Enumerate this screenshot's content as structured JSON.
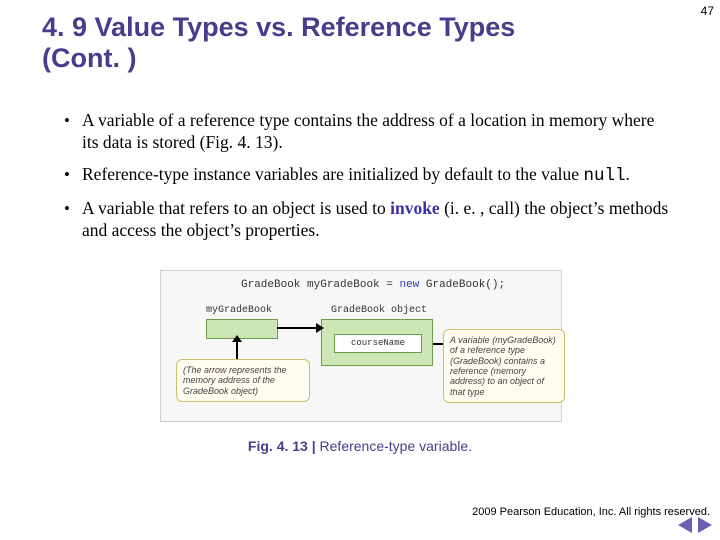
{
  "page_number": "47",
  "title": "4. 9  Value Types vs. Reference Types (Cont. )",
  "bullets": {
    "b1": "A variable of a reference type contains the address of a location in memory where its data is stored (Fig. 4. 13).",
    "b2_pre": "Reference-type instance variables are initialized by default to the value ",
    "b2_code": "null",
    "b2_post": ".",
    "b3_pre": "A variable that refers to an object is used to ",
    "b3_kw": "invoke",
    "b3_post": " (i. e. , call) the object’s methods and access the object’s properties."
  },
  "figure": {
    "code_type": "GradeBook",
    "code_var": "myGradeBook",
    "code_eq": " = ",
    "code_new": "new",
    "code_ctor": " GradeBook();",
    "var_label": "myGradeBook",
    "obj_label": "GradeBook object",
    "obj_field": "courseName",
    "callout_left": "(The arrow represents the memory address of the GradeBook object)",
    "callout_right": "A variable (myGradeBook) of a reference type (GradeBook) contains a reference (memory address) to an object of that type"
  },
  "caption": {
    "bold": "Fig. 4. 13 | ",
    "rest": "Reference-type variable."
  },
  "copyright": "  2009 Pearson Education, Inc.  All rights reserved.",
  "icons": {
    "prev": "prev-slide",
    "next": "next-slide"
  }
}
